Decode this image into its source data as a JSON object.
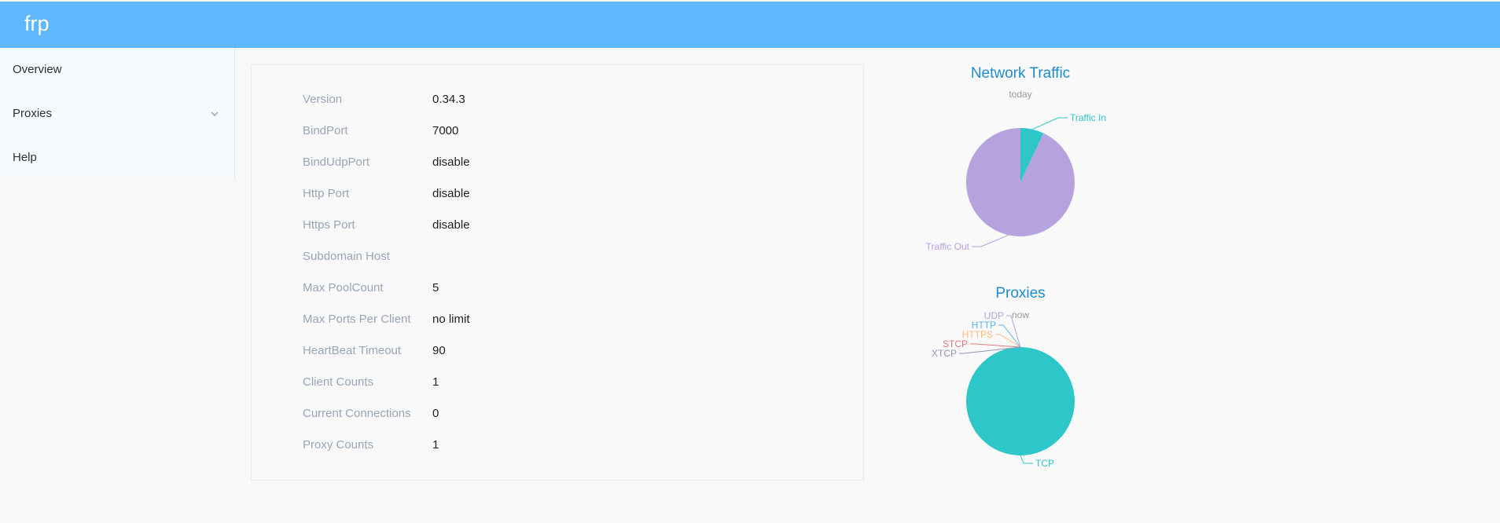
{
  "app": {
    "brand": "frp"
  },
  "sidebar": {
    "items": [
      {
        "label": "Overview"
      },
      {
        "label": "Proxies"
      },
      {
        "label": "Help"
      }
    ]
  },
  "overview": {
    "rows": [
      {
        "key": "Version",
        "value": "0.34.3"
      },
      {
        "key": "BindPort",
        "value": "7000"
      },
      {
        "key": "BindUdpPort",
        "value": "disable"
      },
      {
        "key": "Http Port",
        "value": "disable"
      },
      {
        "key": "Https Port",
        "value": "disable"
      },
      {
        "key": "Subdomain Host",
        "value": ""
      },
      {
        "key": "Max PoolCount",
        "value": "5"
      },
      {
        "key": "Max Ports Per Client",
        "value": "no limit"
      },
      {
        "key": "HeartBeat Timeout",
        "value": "90"
      },
      {
        "key": "Client Counts",
        "value": "1"
      },
      {
        "key": "Current Connections",
        "value": "0"
      },
      {
        "key": "Proxy Counts",
        "value": "1"
      }
    ]
  },
  "colors": {
    "header": "#5fb8fd",
    "title": "#1e8cd1",
    "traffic_in": "#2ec7c9",
    "traffic_out": "#b6a2de",
    "tcp": "#2ec7c9",
    "udp": "#b6a2de",
    "http": "#5ab1ef",
    "https": "#ffb980",
    "stcp": "#d87a80",
    "xtcp": "#8d98b3"
  },
  "chart_data": [
    {
      "type": "pie",
      "title": "Network Traffic",
      "subtitle": "today",
      "slices": [
        {
          "name": "Traffic In",
          "value": 7
        },
        {
          "name": "Traffic Out",
          "value": 93
        }
      ]
    },
    {
      "type": "pie",
      "title": "Proxies",
      "subtitle": "now",
      "slices": [
        {
          "name": "TCP",
          "value": 1
        },
        {
          "name": "UDP",
          "value": 0
        },
        {
          "name": "HTTP",
          "value": 0
        },
        {
          "name": "HTTPS",
          "value": 0
        },
        {
          "name": "STCP",
          "value": 0
        },
        {
          "name": "XTCP",
          "value": 0
        }
      ]
    }
  ]
}
